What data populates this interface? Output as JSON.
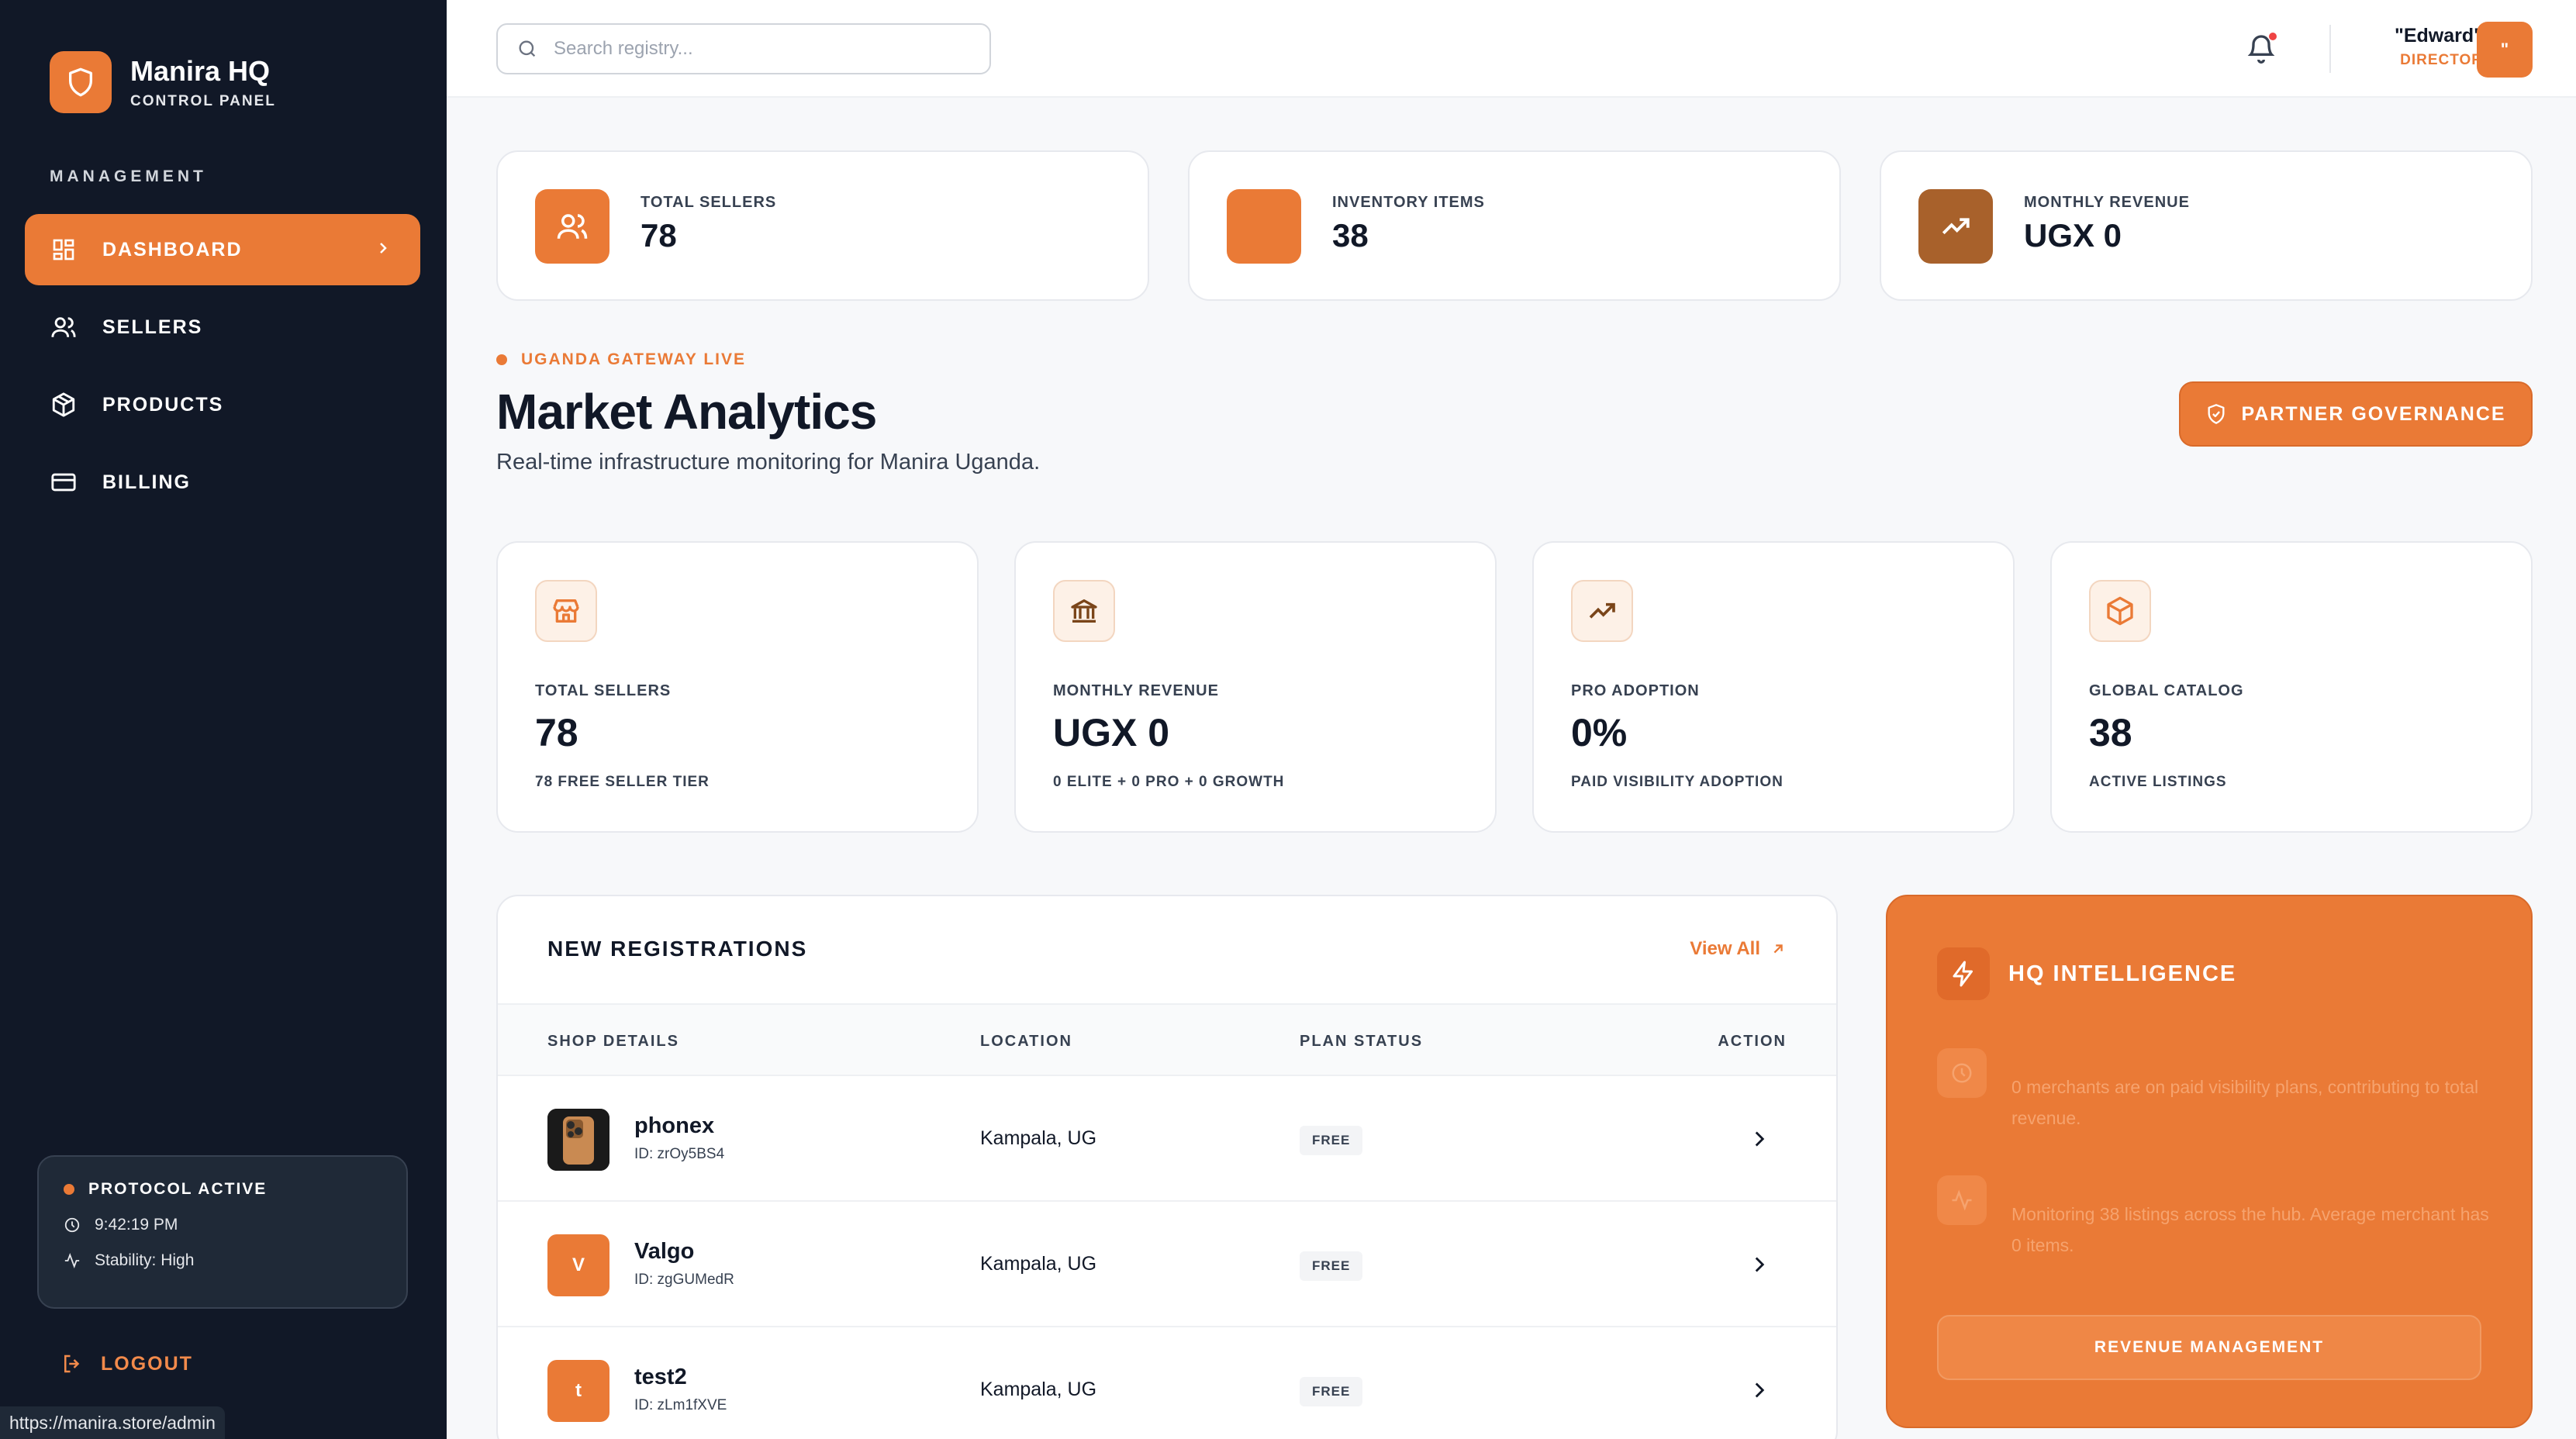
{
  "brand": {
    "title": "Manira HQ",
    "subtitle": "CONTROL PANEL"
  },
  "sidebar": {
    "section_label": "MANAGEMENT",
    "items": [
      {
        "label": "DASHBOARD",
        "icon": "grid-icon",
        "active": true
      },
      {
        "label": "SELLERS",
        "icon": "users-icon",
        "active": false
      },
      {
        "label": "PRODUCTS",
        "icon": "box-icon",
        "active": false
      },
      {
        "label": "BILLING",
        "icon": "credit-card-icon",
        "active": false
      }
    ],
    "protocol": {
      "title": "PROTOCOL ACTIVE",
      "time": "9:42:19 PM",
      "stability": "Stability: High"
    },
    "logout_label": "LOGOUT"
  },
  "status_url": "https://manira.store/admin",
  "topbar": {
    "search_placeholder": "Search registry...",
    "user_name": "\"Edward\"",
    "user_role": "DIRECTOR",
    "avatar_text": "\""
  },
  "top_stats": [
    {
      "label": "TOTAL SELLERS",
      "value": "78"
    },
    {
      "label": "INVENTORY ITEMS",
      "value": "38"
    },
    {
      "label": "MONTHLY REVENUE",
      "value": "UGX 0"
    }
  ],
  "header": {
    "live_label": "UGANDA GATEWAY LIVE",
    "title": "Market Analytics",
    "subtitle": "Real-time infrastructure monitoring for Manira Uganda.",
    "partner_button": "PARTNER GOVERNANCE"
  },
  "metrics": [
    {
      "label": "TOTAL SELLERS",
      "value": "78",
      "sub": "78 FREE SELLER TIER",
      "icon": "store-icon"
    },
    {
      "label": "MONTHLY REVENUE",
      "value": "UGX 0",
      "sub": "0 ELITE + 0 PRO + 0 GROWTH",
      "icon": "bank-icon"
    },
    {
      "label": "PRO ADOPTION",
      "value": "0%",
      "sub": "PAID VISIBILITY ADOPTION",
      "icon": "trending-up-icon"
    },
    {
      "label": "GLOBAL CATALOG",
      "value": "38",
      "sub": "ACTIVE LISTINGS",
      "icon": "box-icon"
    }
  ],
  "registrations": {
    "title": "NEW REGISTRATIONS",
    "view_all": "View All",
    "columns": [
      "SHOP DETAILS",
      "LOCATION",
      "PLAN STATUS",
      "ACTION"
    ],
    "rows": [
      {
        "initial": "",
        "name": "phonex",
        "id": "ID: zrOy5BS4",
        "location": "Kampala, UG",
        "plan": "FREE"
      },
      {
        "initial": "V",
        "name": "Valgo",
        "id": "ID: zgGUMedR",
        "location": "Kampala, UG",
        "plan": "FREE"
      },
      {
        "initial": "t",
        "name": "test2",
        "id": "ID: zLm1fXVE",
        "location": "Kampala, UG",
        "plan": "FREE"
      }
    ]
  },
  "intelligence": {
    "title": "HQ INTELLIGENCE",
    "insights": [
      "0 merchants are on paid visibility plans, contributing to total revenue.",
      "Monitoring 38 listings across the hub. Average merchant has 0 items."
    ],
    "button": "REVENUE MANAGEMENT"
  },
  "colors": {
    "accent": "#ea7a36",
    "sidebar": "#111827",
    "revenue_icon": "#a8612b"
  }
}
